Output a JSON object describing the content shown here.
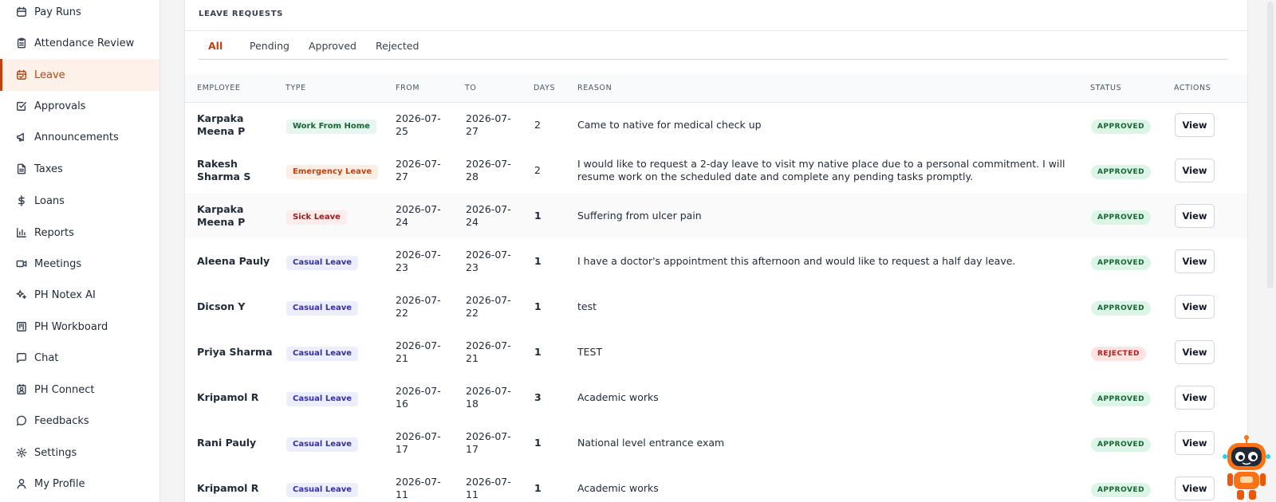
{
  "sidebar": {
    "items": [
      {
        "label": "Pay Runs",
        "icon": "calendar-icon"
      },
      {
        "label": "Attendance Review",
        "icon": "clipboard-icon"
      },
      {
        "label": "Leave",
        "icon": "calendar-check-icon",
        "active": true
      },
      {
        "label": "Approvals",
        "icon": "check-square-icon"
      },
      {
        "label": "Announcements",
        "icon": "megaphone-icon"
      },
      {
        "label": "Taxes",
        "icon": "file-text-icon"
      },
      {
        "label": "Loans",
        "icon": "dollar-icon"
      },
      {
        "label": "Reports",
        "icon": "bar-chart-icon"
      },
      {
        "label": "Meetings",
        "icon": "video-icon"
      },
      {
        "label": "PH Notex AI",
        "icon": "sparkles-icon"
      },
      {
        "label": "PH Workboard",
        "icon": "kanban-icon"
      },
      {
        "label": "Chat",
        "icon": "message-square-icon"
      },
      {
        "label": "PH Connect",
        "icon": "contact-icon"
      },
      {
        "label": "Feedbacks",
        "icon": "message-circle-icon"
      },
      {
        "label": "Settings",
        "icon": "gear-icon"
      },
      {
        "label": "My Profile",
        "icon": "user-icon"
      }
    ]
  },
  "panel": {
    "title": "LEAVE REQUESTS",
    "tabs": [
      "All",
      "Pending",
      "Approved",
      "Rejected"
    ],
    "active_tab": "All"
  },
  "table": {
    "headers": [
      "EMPLOYEE",
      "TYPE",
      "FROM",
      "TO",
      "DAYS",
      "REASON",
      "STATUS",
      "ACTIONS"
    ],
    "action_label": "View",
    "rows": [
      {
        "employee": "Karpaka Meena P",
        "type": "Work From Home",
        "from": "2026-07-25",
        "to": "2026-07-27",
        "days": "2",
        "reason": "Came to native for medical check up",
        "status": "APPROVED"
      },
      {
        "employee": "Rakesh Sharma S",
        "type": "Emergency Leave",
        "from": "2026-07-27",
        "to": "2026-07-28",
        "days": "2",
        "reason": "I would like to request a 2-day leave to visit my native place due to a personal commitment. I will resume work on the scheduled date and complete any pending tasks promptly.",
        "status": "APPROVED"
      },
      {
        "employee": "Karpaka Meena P",
        "type": "Sick Leave",
        "from": "2026-07-24",
        "to": "2026-07-24",
        "days": "1",
        "reason": "Suffering from ulcer pain",
        "status": "APPROVED"
      },
      {
        "employee": "Aleena Pauly",
        "type": "Casual Leave",
        "from": "2026-07-23",
        "to": "2026-07-23",
        "days": "1",
        "reason": "I have a doctor's appointment this afternoon and would like to request a half day leave.",
        "status": "APPROVED"
      },
      {
        "employee": "Dicson Y",
        "type": "Casual Leave",
        "from": "2026-07-22",
        "to": "2026-07-22",
        "days": "1",
        "reason": "test",
        "status": "APPROVED"
      },
      {
        "employee": "Priya Sharma",
        "type": "Casual Leave",
        "from": "2026-07-21",
        "to": "2026-07-21",
        "days": "1",
        "reason": "TEST",
        "status": "REJECTED"
      },
      {
        "employee": "Kripamol R",
        "type": "Casual Leave",
        "from": "2026-07-16",
        "to": "2026-07-18",
        "days": "3",
        "reason": "Academic works",
        "status": "APPROVED"
      },
      {
        "employee": "Rani Pauly",
        "type": "Casual Leave",
        "from": "2026-07-17",
        "to": "2026-07-17",
        "days": "1",
        "reason": "National level entrance exam",
        "status": "APPROVED"
      },
      {
        "employee": "Kripamol R",
        "type": "Casual Leave",
        "from": "2026-07-11",
        "to": "2026-07-11",
        "days": "1",
        "reason": "Academic works",
        "status": "APPROVED"
      }
    ]
  },
  "colors": {
    "accent": "#c2410c",
    "type_work_from_home": {
      "bg": "#e7f6ee",
      "fg": "#166534"
    },
    "type_emergency": {
      "bg": "#fdeee4",
      "fg": "#c2410c"
    },
    "type_sick": {
      "bg": "#fdecec",
      "fg": "#991b1b"
    },
    "type_casual": {
      "bg": "#eceefb",
      "fg": "#3730a3"
    },
    "status_approved": {
      "bg": "#dcf5e7",
      "fg": "#166534"
    },
    "status_rejected": {
      "bg": "#fde2e2",
      "fg": "#b91c1c"
    }
  },
  "assistant": {
    "icon": "robot-assistant-icon"
  }
}
